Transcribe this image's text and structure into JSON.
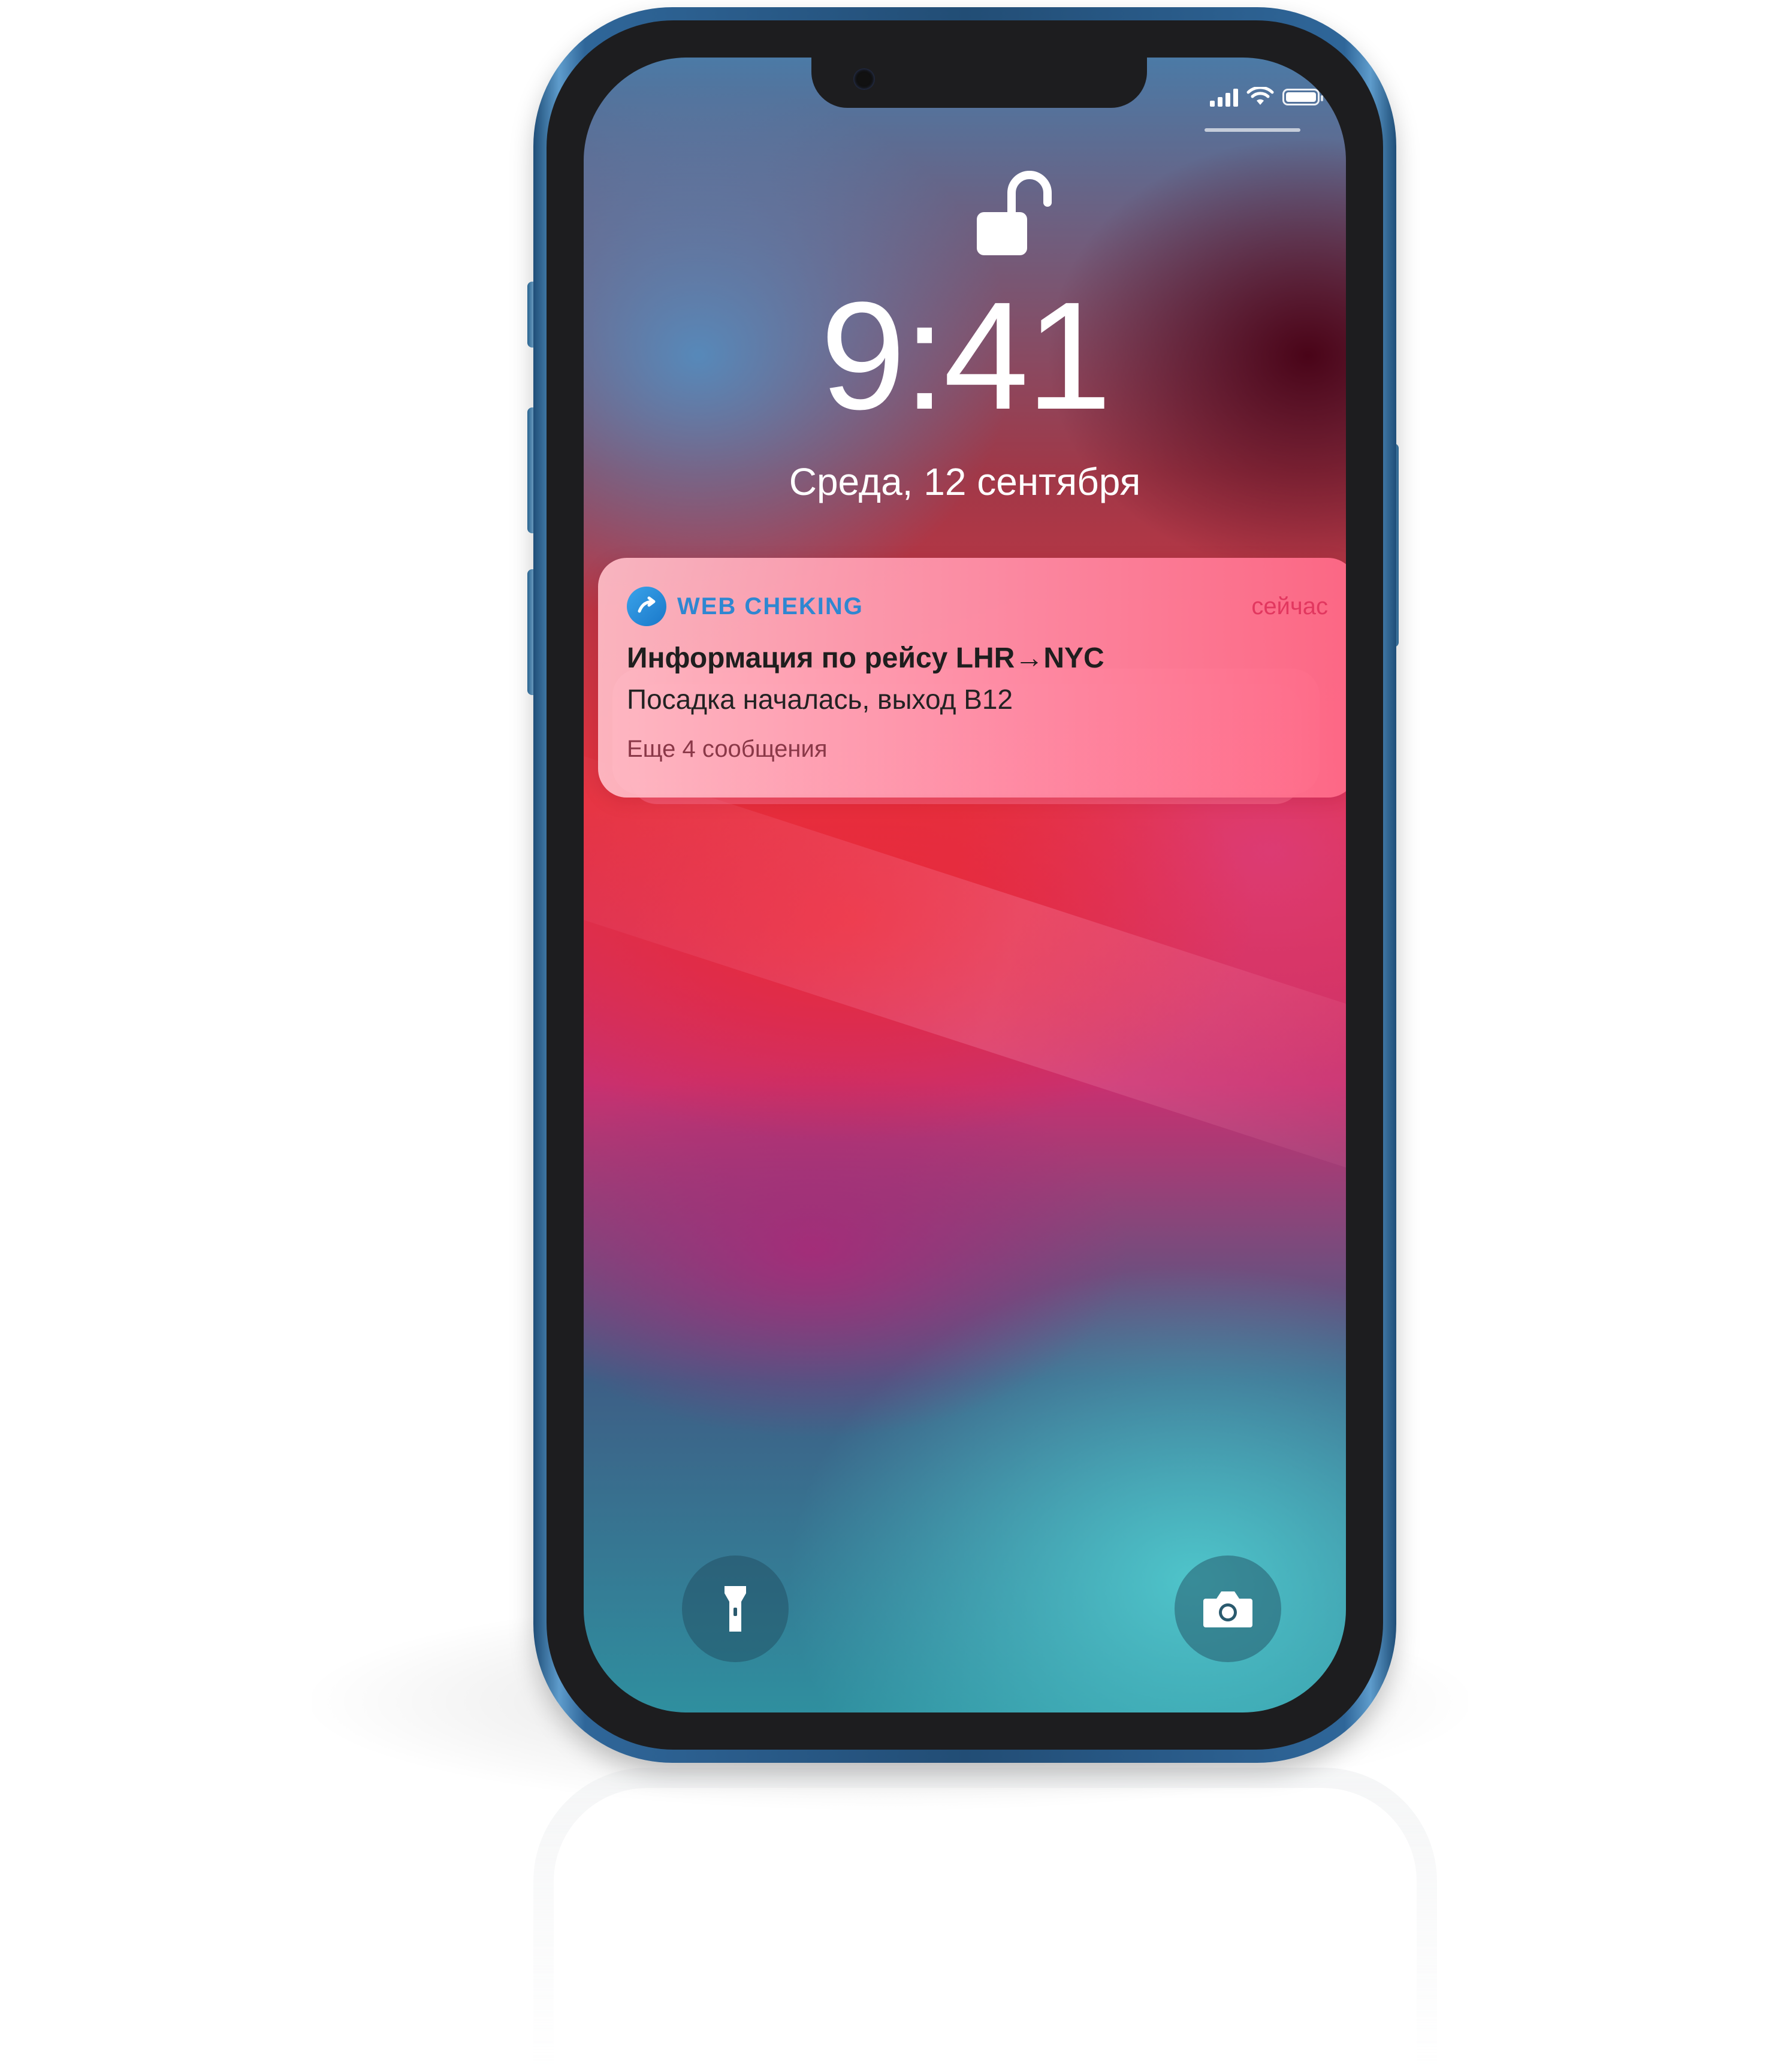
{
  "status_bar": {
    "signal_icon": "cellular-signal-icon",
    "wifi_icon": "wifi-icon",
    "battery_icon": "battery-icon",
    "battery_level": 1.0
  },
  "lock_screen": {
    "lock_icon": "unlocked-padlock-icon",
    "time": "9:41",
    "date": "Среда, 12 сентября"
  },
  "notification": {
    "app_icon": "airplane-arrow-icon",
    "app_name": "WEB CHEKING",
    "timestamp": "сейчас",
    "title": "Информация по рейсу LHR→NYC",
    "body": "Посадка началась, выход B12",
    "more": "Еще 4 сообщения",
    "accent_color": "#e2375f",
    "app_color": "#2f87d1"
  },
  "controls": {
    "flashlight_icon": "flashlight-icon",
    "camera_icon": "camera-icon"
  }
}
